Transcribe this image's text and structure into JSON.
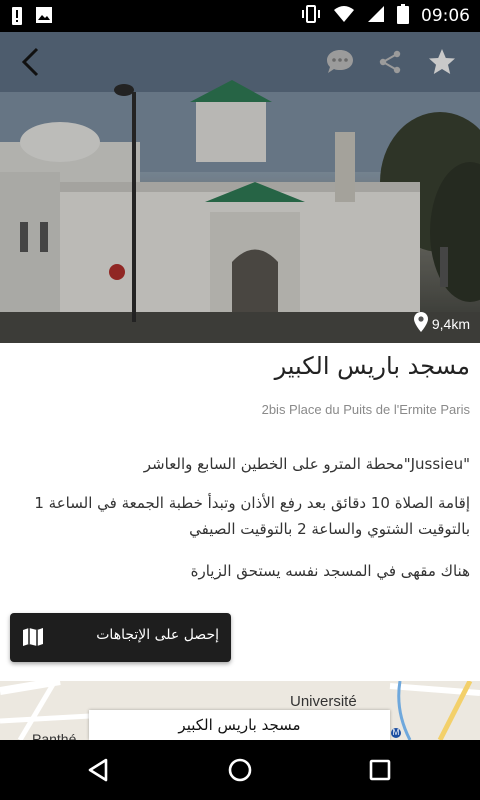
{
  "status_bar": {
    "time": "09:06",
    "left_icons": [
      "alert-icon",
      "image-icon"
    ],
    "right_icons": [
      "vibrate-icon",
      "wifi-icon",
      "signal-icon",
      "battery-icon"
    ]
  },
  "toolbar": {
    "back_icon": "arrow-left-icon",
    "comment_icon": "comment-icon",
    "share_icon": "share-icon",
    "favorite_icon": "star-icon"
  },
  "hero": {
    "distance": "9,4km",
    "distance_icon": "location-pin-icon"
  },
  "place": {
    "title": "مسجد باريس الكبير",
    "address": "2bis Place du Puits de l'Ermite Paris",
    "paragraphs": [
      "\"Jussieu\"محطة المترو على الخطين السابع والعاشر",
      "إقامة الصلاة 10 دقائق بعد رفع الأذان وتبدأ خطبة الجمعة في الساعة 1 بالتوقيت الشتوي والساعة 2 بالتوقيت الصيفي",
      "هناك مقهى في المسجد نفسه يستحق الزيارة"
    ]
  },
  "directions_button": {
    "label": "إحصل على الإتجاهات",
    "icon": "map-icon"
  },
  "map": {
    "labels": {
      "universite": "Université",
      "panthe": "Panthé"
    },
    "callout": "مسجد باريس الكبير",
    "metro_badge": "M"
  },
  "nav_bar": {
    "back": "back-triangle-icon",
    "home": "home-circle-icon",
    "recents": "recents-square-icon"
  }
}
